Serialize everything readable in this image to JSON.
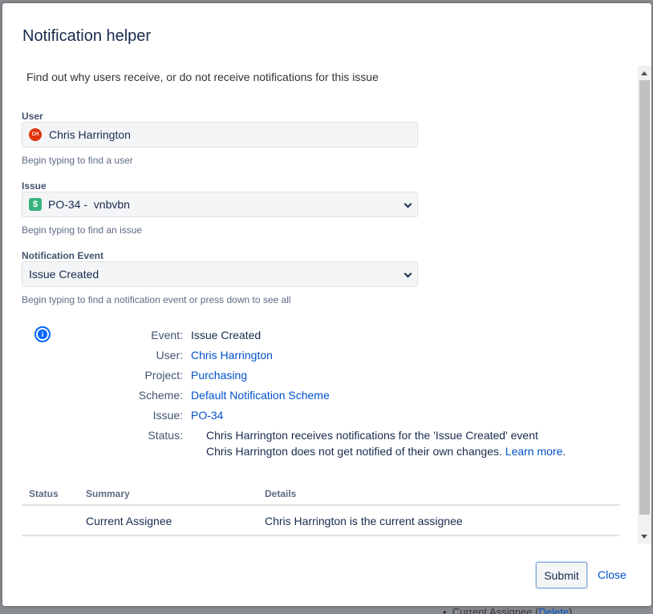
{
  "dialog": {
    "title": "Notification helper",
    "intro": "Find out why users receive, or do not receive notifications for this issue"
  },
  "user_field": {
    "label": "User",
    "avatar_initials": "CH",
    "value": "Chris Harrington",
    "help": "Begin typing to find a user"
  },
  "issue_field": {
    "label": "Issue",
    "issue_type_icon": "$",
    "value": "PO-34 -  vnbvbn",
    "help": "Begin typing to find an issue"
  },
  "event_field": {
    "label": "Notification Event",
    "value": "Issue Created",
    "help": "Begin typing to find a notification event or press down to see all"
  },
  "info": {
    "icon": "info-icon",
    "event_key": "Event:",
    "event_val": "Issue Created",
    "user_key": "User:",
    "user_val": "Chris Harrington",
    "project_key": "Project:",
    "project_val": "Purchasing",
    "scheme_key": "Scheme:",
    "scheme_val": "Default Notification Scheme",
    "issue_key": "Issue:",
    "issue_val": "PO-34",
    "status_key": "Status:",
    "status_line1": "Chris Harrington receives notifications for the 'Issue Created' event",
    "status_line2": "Chris Harrington does not get notified of their own changes.",
    "learn_more": "Learn more",
    "period": "."
  },
  "table": {
    "headers": [
      "Status",
      "Summary",
      "Details"
    ],
    "rows": [
      {
        "status": "",
        "summary": "Current Assignee",
        "details": "Chris Harrington is the current assignee"
      }
    ]
  },
  "actions": {
    "submit": "Submit",
    "close": "Close"
  },
  "background": {
    "bullet": "•",
    "footer_text": "Current Assignee (",
    "footer_link": "Delete",
    "footer_end": ")"
  },
  "colors": {
    "link": "#0052cc",
    "accent": "#0065ff",
    "avatar": "#de350b",
    "issue_type": "#36b37e"
  }
}
